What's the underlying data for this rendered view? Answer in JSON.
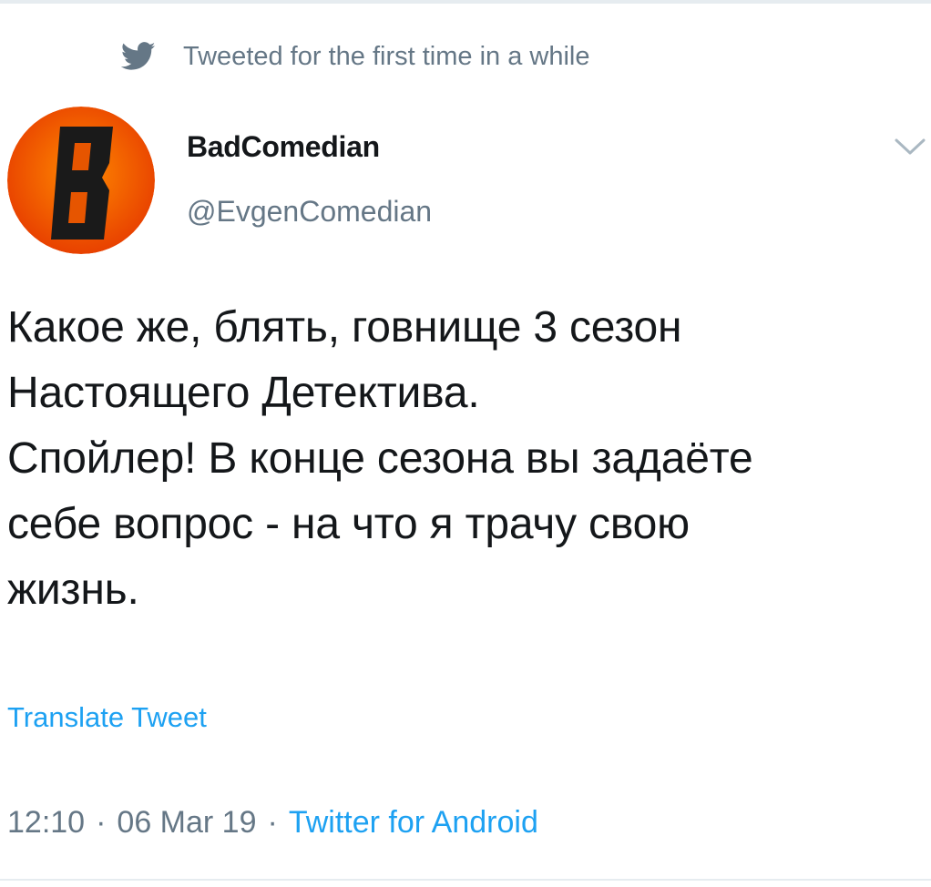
{
  "social_context": {
    "icon": "twitter-bird-icon",
    "text": "Tweeted for the first time in a while"
  },
  "author": {
    "display_name": "BadComedian",
    "handle": "@EvgenComedian",
    "avatar_letter": "B",
    "avatar_colors": {
      "outer": "#e63a00",
      "inner": "#ff8a00",
      "letter": "#1a1a1a"
    }
  },
  "tweet": {
    "text": "Какое же, блять, говнище 3 сезон\nНастоящего Детектива.\nСпойлер! В конце сезона вы задаёте\nсебе вопрос - на что я трачу свою\nжизнь.",
    "translate_label": "Translate Tweet",
    "time": "12:10",
    "date": "06 Mar 19",
    "separator": "·",
    "source": "Twitter for Android"
  },
  "colors": {
    "text": "#14171a",
    "muted": "#657786",
    "link": "#1da1f2",
    "divider": "#e6ecf0"
  }
}
